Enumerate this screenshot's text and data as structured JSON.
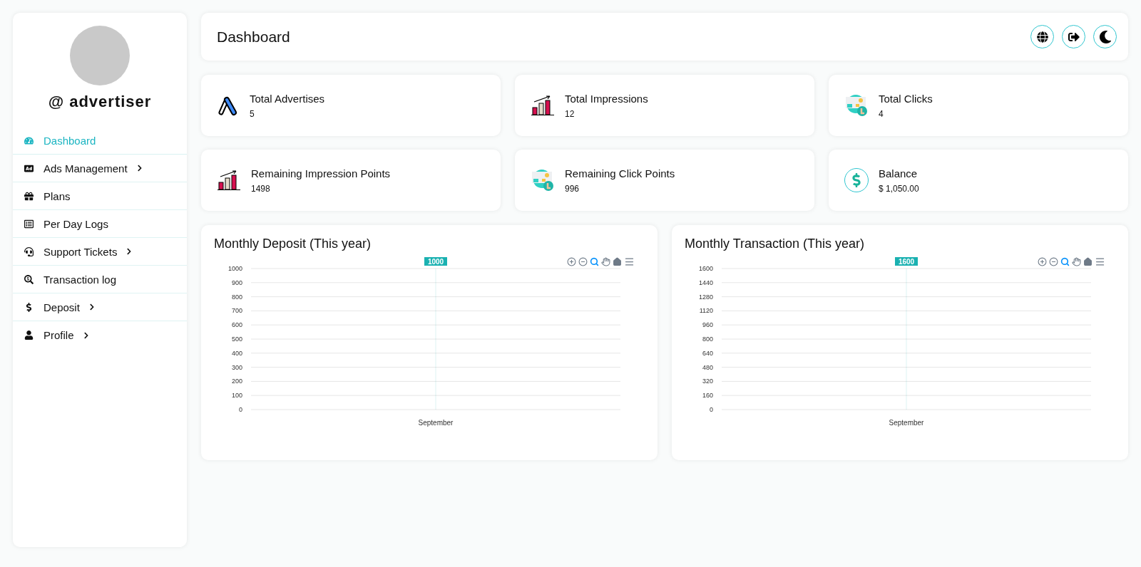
{
  "sidebar": {
    "username": "@ advertiser",
    "items": [
      {
        "label": "Dashboard",
        "kind": "gauge",
        "selected": true,
        "submenu": false
      },
      {
        "label": "Ads Management",
        "kind": "ad",
        "selected": false,
        "submenu": true
      },
      {
        "label": "Plans",
        "kind": "gift",
        "selected": false,
        "submenu": false
      },
      {
        "label": "Per Day Logs",
        "kind": "list",
        "selected": false,
        "submenu": false
      },
      {
        "label": "Support Tickets",
        "kind": "headset",
        "selected": false,
        "submenu": true
      },
      {
        "label": "Transaction log",
        "kind": "search",
        "selected": false,
        "submenu": false
      },
      {
        "label": "Deposit",
        "kind": "dollar",
        "selected": false,
        "submenu": true
      },
      {
        "label": "Profile",
        "kind": "user",
        "selected": false,
        "submenu": true
      }
    ]
  },
  "header": {
    "title": "Dashboard"
  },
  "stats": [
    {
      "label": "Total Advertises",
      "value": "5",
      "kind": "ads"
    },
    {
      "label": "Total Impressions",
      "value": "12",
      "kind": "bars"
    },
    {
      "label": "Total Clicks",
      "value": "4",
      "kind": "clicks"
    },
    {
      "label": "Remaining Impression Points",
      "value": "1498",
      "kind": "bars"
    },
    {
      "label": "Remaining Click Points",
      "value": "996",
      "kind": "clicks"
    },
    {
      "label": "Balance",
      "value": "$ 1,050.00",
      "kind": "money"
    }
  ],
  "charts": [
    {
      "title": "Monthly Deposit (This year)",
      "chart_data": {
        "type": "bar",
        "categories": [
          "September"
        ],
        "series": [
          {
            "color": "#1ab1b1",
            "values": [
              1000
            ]
          }
        ],
        "grid": true,
        "ylim": [
          0,
          1000
        ],
        "yticks": [
          0,
          100,
          200,
          300,
          400,
          500,
          600,
          700,
          800,
          900,
          1000
        ],
        "data_labels": true
      }
    },
    {
      "title": "Monthly Transaction (This year)",
      "chart_data": {
        "type": "bar",
        "categories": [
          "September"
        ],
        "series": [
          {
            "color": "#1ab1b1",
            "values": [
              1600
            ]
          }
        ],
        "grid": true,
        "ylim": [
          0,
          1600
        ],
        "yticks": [
          0,
          160,
          320,
          480,
          640,
          800,
          960,
          1120,
          1280,
          1440,
          1600
        ],
        "data_labels": true
      }
    }
  ]
}
